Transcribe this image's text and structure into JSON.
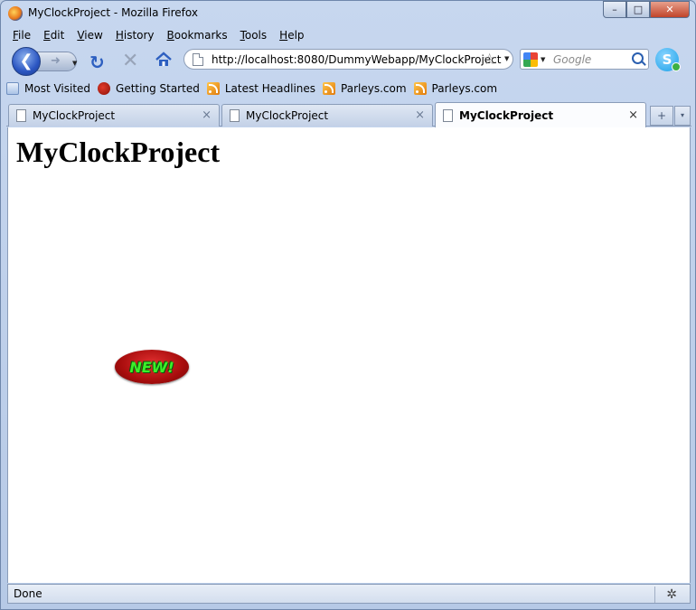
{
  "window": {
    "title": "MyClockProject - Mozilla Firefox",
    "controls": {
      "minimize": "–",
      "maximize": "□",
      "close": "✕"
    }
  },
  "menu": {
    "items": [
      {
        "label": "File",
        "accel": "F",
        "rest": "ile"
      },
      {
        "label": "Edit",
        "accel": "E",
        "rest": "dit"
      },
      {
        "label": "View",
        "accel": "V",
        "rest": "iew"
      },
      {
        "label": "History",
        "accel": "H",
        "rest": "istory"
      },
      {
        "label": "Bookmarks",
        "accel": "B",
        "rest": "ookmarks"
      },
      {
        "label": "Tools",
        "accel": "T",
        "rest": "ools"
      },
      {
        "label": "Help",
        "accel": "H",
        "rest": "elp"
      }
    ]
  },
  "navbar": {
    "url": "http://localhost:8080/DummyWebapp/MyClockProject",
    "search_placeholder": "Google",
    "icons": {
      "back": "back-arrow-icon",
      "forward": "forward-arrow-icon",
      "reload": "reload-icon",
      "stop": "stop-icon",
      "home": "home-icon",
      "bookmark_star": "star-icon",
      "search_engine": "google-icon",
      "search": "magnifier-icon",
      "skype": "skype-icon"
    }
  },
  "bookmarks": {
    "items": [
      {
        "label": "Most Visited",
        "icon": "most-visited-icon"
      },
      {
        "label": "Getting Started",
        "icon": "firefox-started-icon"
      },
      {
        "label": "Latest Headlines",
        "icon": "rss-icon"
      },
      {
        "label": "Parleys.com",
        "icon": "rss-icon"
      },
      {
        "label": "Parleys.com",
        "icon": "rss-icon"
      }
    ]
  },
  "tabs": {
    "items": [
      {
        "label": "MyClockProject",
        "active": false
      },
      {
        "label": "MyClockProject",
        "active": false
      },
      {
        "label": "MyClockProject",
        "active": true
      }
    ],
    "close_glyph": "×",
    "new_tab_glyph": "+",
    "list_glyph": "▾"
  },
  "content": {
    "heading": "MyClockProject",
    "badge_text": "NEW!"
  },
  "statusbar": {
    "text": "Done"
  },
  "colors": {
    "chrome_bg": "#bfcfe6",
    "badge_red": "#c41414",
    "badge_text_green": "#3cef2a"
  }
}
